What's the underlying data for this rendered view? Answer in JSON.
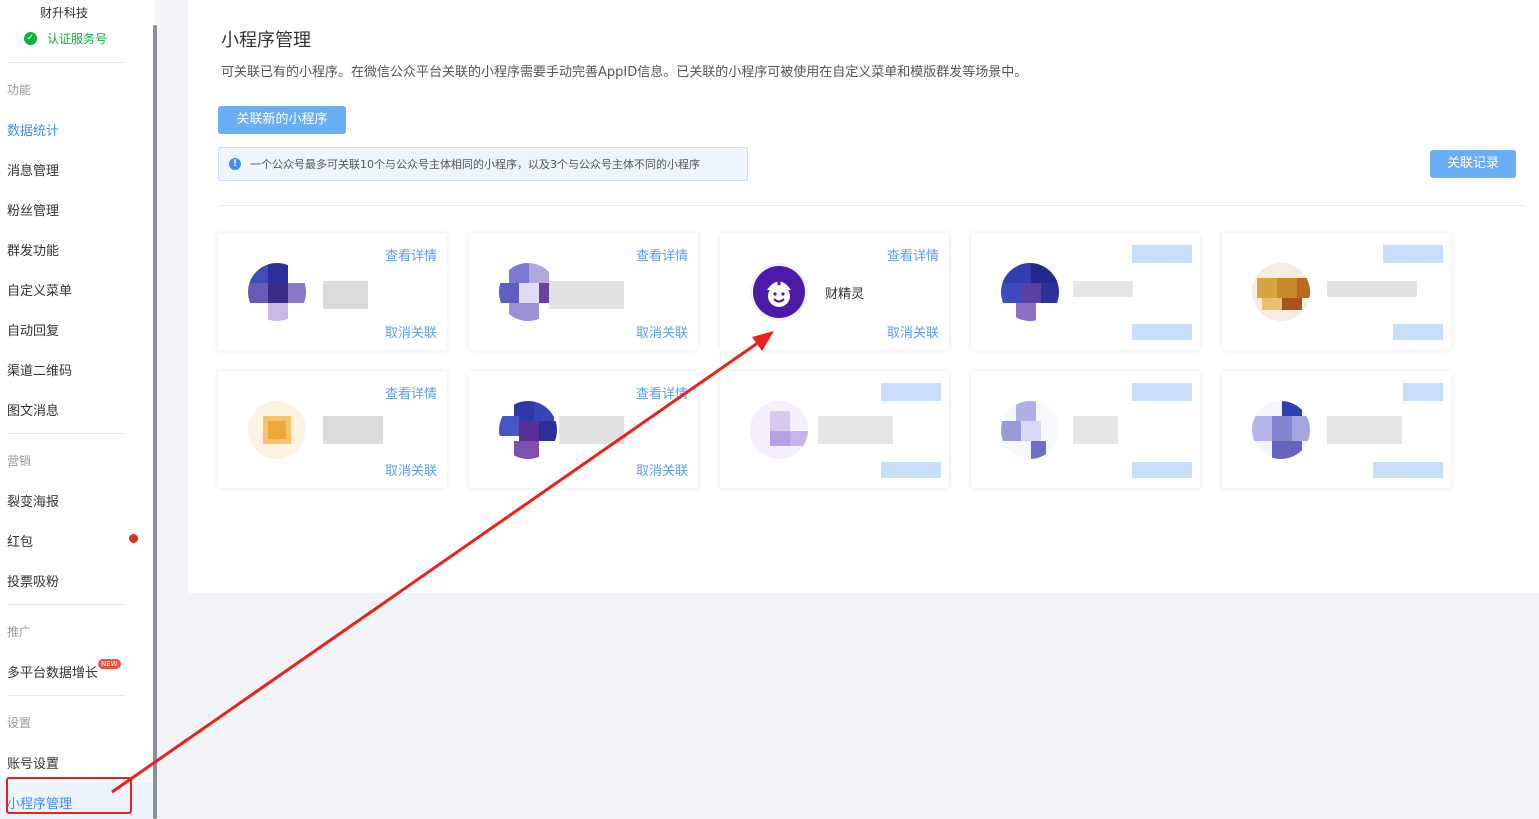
{
  "sidebar": {
    "account_name": "财升科技",
    "verified_label": "认证服务号",
    "sections": [
      {
        "title": "功能",
        "items": [
          "数据统计",
          "消息管理",
          "粉丝管理",
          "群发功能",
          "自定义菜单",
          "自动回复",
          "渠道二维码",
          "图文消息"
        ]
      },
      {
        "title": "营销",
        "items": [
          "裂变海报",
          "红包",
          "投票吸粉"
        ]
      },
      {
        "title": "推广",
        "items": [
          "多平台数据增长"
        ]
      },
      {
        "title": "设置",
        "items": [
          "账号设置",
          "小程序管理"
        ]
      }
    ],
    "new_badge": "NEW"
  },
  "main": {
    "title": "小程序管理",
    "description": "可关联已有的小程序。在微信公众平台关联的小程序需要手动完善AppID信息。已关联的小程序可被使用在自定义菜单和模版群发等场景中。",
    "link_new_button": "关联新的小程序",
    "records_button": "关联记录",
    "notice": "一个公众号最多可关联10个与公众号主体相同的小程序，以及3个与公众号主体不同的小程序",
    "card_detail_label": "查看详情",
    "card_unlink_label": "取消关联",
    "visible_card_name": "财精灵"
  },
  "colors": {
    "accent": "#3b8ef5",
    "button": "#6aaef6",
    "link": "#5a9df3",
    "annotation": "#e8231d",
    "verified": "#07b33a"
  }
}
